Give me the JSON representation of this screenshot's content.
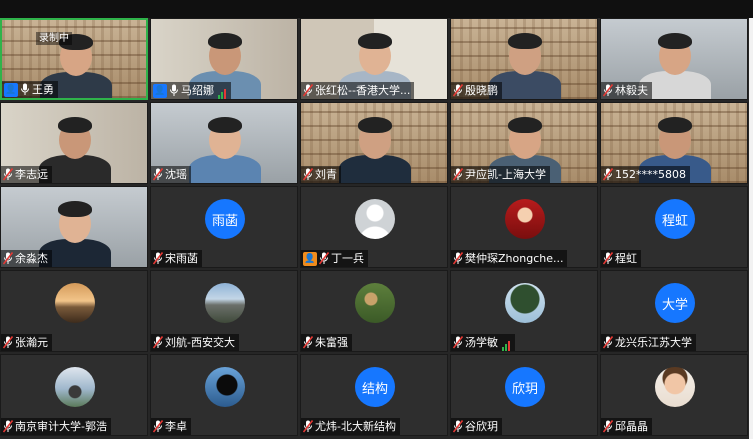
{
  "recording_label": "录制中",
  "tiles": [
    {
      "name": "王勇",
      "host": true,
      "active": true,
      "kind": "video",
      "bg": "shelf"
    },
    {
      "name": "马绍娜",
      "host": true,
      "kind": "video",
      "bg": "room",
      "bars": true
    },
    {
      "name": "张红松--香港大学...",
      "kind": "video",
      "bg": "office"
    },
    {
      "name": "殷晓鹏",
      "kind": "video",
      "bg": "shelf"
    },
    {
      "name": "林毅夫",
      "kind": "video",
      "bg": "room2"
    },
    {
      "name": "李志远",
      "kind": "video",
      "bg": "room"
    },
    {
      "name": "沈瑶",
      "kind": "video",
      "bg": "room2"
    },
    {
      "name": "刘青",
      "kind": "video",
      "bg": "shelf"
    },
    {
      "name": "尹应凯-上海大学",
      "kind": "video",
      "bg": "shelf"
    },
    {
      "name": "152****5808",
      "kind": "video",
      "bg": "shelf"
    },
    {
      "name": "余淼杰",
      "kind": "video",
      "bg": "room2"
    },
    {
      "name": "宋雨菡",
      "kind": "avatar",
      "text": "雨菡",
      "color": "#1677ff"
    },
    {
      "name": "丁一兵",
      "kind": "img",
      "img": "gray",
      "host_orange": true
    },
    {
      "name": "樊仲琛Zhongche...",
      "kind": "img",
      "img": "red"
    },
    {
      "name": "程虹",
      "kind": "avatar",
      "text": "程虹",
      "color": "#1677ff"
    },
    {
      "name": "张瀚元",
      "kind": "img",
      "img": "sunset"
    },
    {
      "name": "刘航-西安交大",
      "kind": "img",
      "img": "mountain"
    },
    {
      "name": "朱富强",
      "kind": "img",
      "img": "forest"
    },
    {
      "name": "汤学敏",
      "kind": "img",
      "img": "tree",
      "bars": true
    },
    {
      "name": "龙兴乐江苏大学",
      "kind": "avatar",
      "text": "大学",
      "color": "#1677ff"
    },
    {
      "name": "南京审计大学-郭浩",
      "kind": "img",
      "img": "sky"
    },
    {
      "name": "李卓",
      "kind": "img",
      "img": "night"
    },
    {
      "name": "尤炜-北大新结构",
      "kind": "avatar",
      "text": "结构",
      "color": "#1677ff"
    },
    {
      "name": "谷欣玥",
      "kind": "avatar",
      "text": "欣玥",
      "color": "#1677ff"
    },
    {
      "name": "邱晶晶",
      "kind": "img",
      "img": "child"
    }
  ]
}
